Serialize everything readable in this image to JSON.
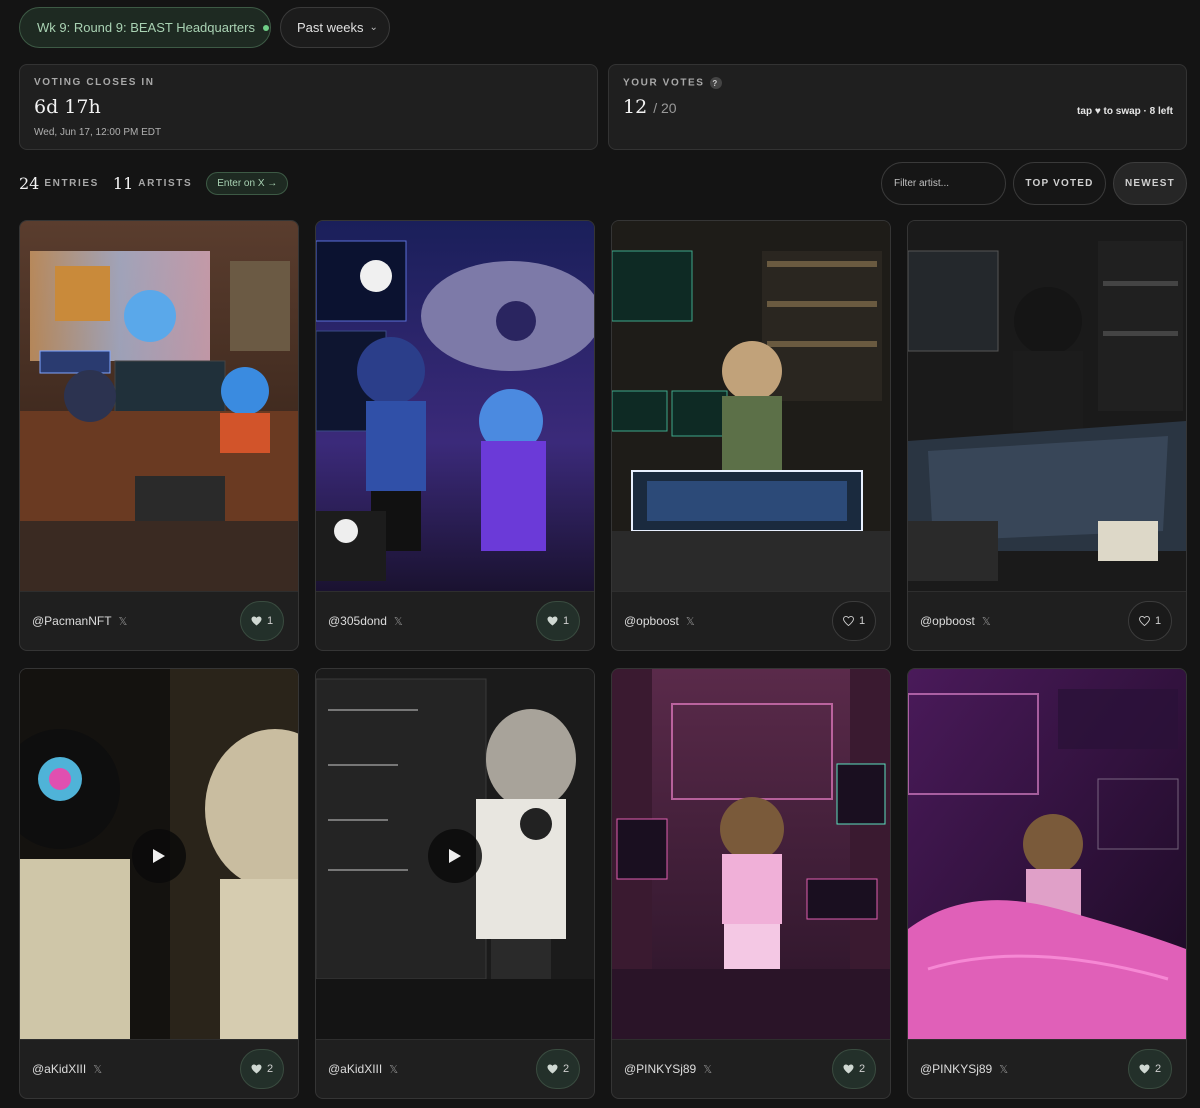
{
  "round": {
    "label": "Wk 9: Round 9: BEAST Headquarters"
  },
  "past_weeks": {
    "label": "Past weeks"
  },
  "voting": {
    "label": "VOTING CLOSES IN",
    "countdown": "6d 17h",
    "deadline": "Wed, Jun 17, 12:00 PM EDT"
  },
  "votes": {
    "label": "YOUR VOTES",
    "help": "?",
    "used": "12",
    "max": "/ 20",
    "hint": "tap ♥ to swap · 8 left"
  },
  "stats": {
    "entries_count": "24",
    "entries_label": "ENTRIES",
    "artists_count": "11",
    "artists_label": "ARTISTS",
    "enter_label": "Enter on X →"
  },
  "filter": {
    "placeholder": "Filter artist..."
  },
  "sort": {
    "top_voted": "TOP VOTED",
    "newest": "NEWEST"
  },
  "entries": [
    {
      "handle": "@PacmanNFT",
      "x": "𝕏",
      "votes": "1",
      "voted": true,
      "video": false
    },
    {
      "handle": "@305dond",
      "x": "𝕏",
      "votes": "1",
      "voted": true,
      "video": false
    },
    {
      "handle": "@opboost",
      "x": "𝕏",
      "votes": "1",
      "voted": false,
      "video": false
    },
    {
      "handle": "@opboost",
      "x": "𝕏",
      "votes": "1",
      "voted": false,
      "video": false
    },
    {
      "handle": "@aKidXIII",
      "x": "𝕏",
      "votes": "2",
      "voted": true,
      "video": true
    },
    {
      "handle": "@aKidXIII",
      "x": "𝕏",
      "votes": "2",
      "voted": true,
      "video": true
    },
    {
      "handle": "@PINKYSj89",
      "x": "𝕏",
      "votes": "2",
      "voted": true,
      "video": false
    },
    {
      "handle": "@PINKYSj89",
      "x": "𝕏",
      "votes": "2",
      "voted": true,
      "video": false
    }
  ],
  "colors": {
    "accent": "#6fcf87",
    "accent_text": "#a9d2b3",
    "background": "#141414"
  }
}
